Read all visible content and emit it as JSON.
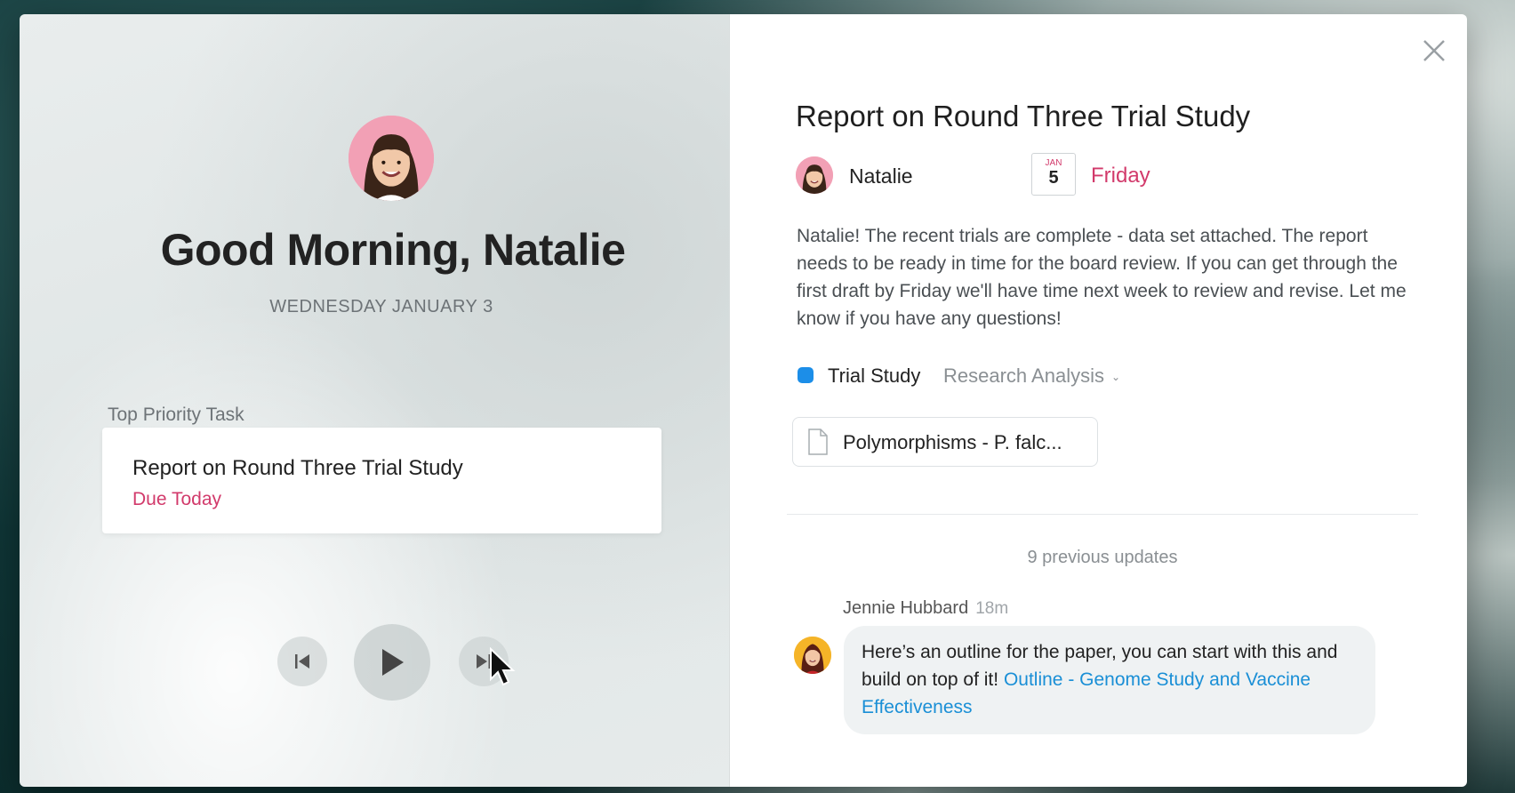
{
  "left_panel": {
    "greeting": "Good Morning, Natalie",
    "date": "WEDNESDAY JANUARY 3",
    "priority_label": "Top Priority Task",
    "task": {
      "title": "Report on Round Three Trial Study",
      "due": "Due Today"
    },
    "controls": [
      "skip-previous-icon",
      "play-icon",
      "skip-next-icon"
    ]
  },
  "detail": {
    "title": "Report on Round Three Trial Study",
    "assignee": "Natalie",
    "due_month": "JAN",
    "due_date_number": "5",
    "due_day": "Friday",
    "description": "Natalie! The recent trials are complete - data set attached. The report needs to be ready in time for the board review. If you can get through the first draft by Friday we'll have time next week to review and revise. Let me know if you have any questions!",
    "project": "Trial Study",
    "section": "Research Analysis",
    "attachment": "Polymorphisms - P. falc...",
    "previous_updates": "9 previous updates",
    "comment": {
      "author": "Jennie Hubbard",
      "time": "18m",
      "text": "Here’s an outline for the paper, you can start with this and build on top of it! ",
      "link": "Outline - Genome Study and Vaccine Effectiveness"
    }
  },
  "colors": {
    "accent_pink": "#d23a6b",
    "project_blue": "#1c8ee8",
    "link_blue": "#1a8fd6"
  }
}
